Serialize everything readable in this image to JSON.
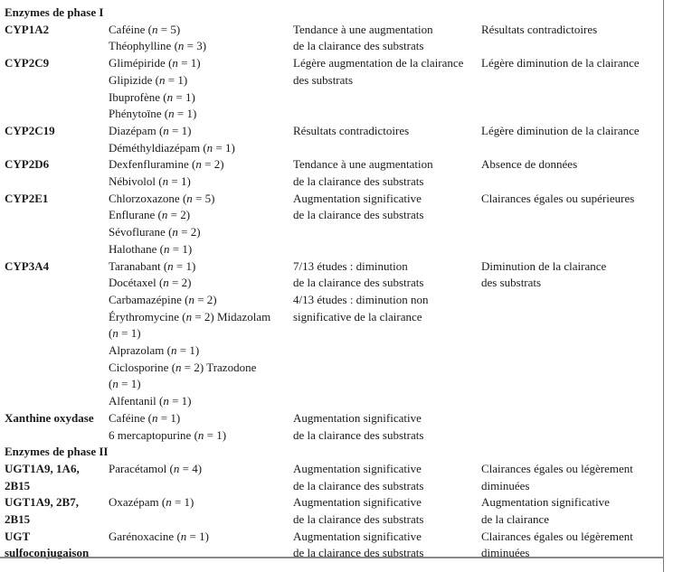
{
  "table": {
    "sections": [
      {
        "title": "Enzymes de phase I",
        "rows": [
          {
            "enzyme": [
              "CYP1A2"
            ],
            "substrates": [
              "Caféine (n = 5)",
              "Théophylline (n = 3)"
            ],
            "effect": [
              "Tendance à une augmentation",
              "de la clairance des substrats"
            ],
            "result": [
              "Résultats contradictoires"
            ]
          },
          {
            "enzyme": [
              "CYP2C9"
            ],
            "substrates": [
              "Glimépiride (n = 1)",
              "Glipizide (n = 1)",
              "Ibuprofène (n = 1)",
              "Phénytoïne (n = 1)"
            ],
            "effect": [
              "Légère augmentation de la clairance",
              "des substrats"
            ],
            "result": [
              "Légère diminution de la clairance"
            ]
          },
          {
            "enzyme": [
              "CYP2C19"
            ],
            "substrates": [
              "Diazépam (n = 1)",
              "Déméthyldiazépam (n = 1)"
            ],
            "effect": [
              "Résultats contradictoires"
            ],
            "result": [
              "Légère diminution de la clairance"
            ]
          },
          {
            "enzyme": [
              "CYP2D6"
            ],
            "substrates": [
              "Dexfenfluramine (n = 2)",
              "Nébivolol (n = 1)"
            ],
            "effect": [
              "Tendance à une augmentation",
              "de la clairance des substrats"
            ],
            "result": [
              "Absence de données"
            ]
          },
          {
            "enzyme": [
              "CYP2E1"
            ],
            "substrates": [
              "Chlorzoxazone (n = 5)",
              "Enflurane (n = 2)",
              "Sévoflurane (n = 2)",
              "Halothane (n = 1)"
            ],
            "effect": [
              "Augmentation significative",
              "de la clairance des substrats"
            ],
            "result": [
              "Clairances égales ou supérieures"
            ]
          },
          {
            "enzyme": [
              "CYP3A4"
            ],
            "substrates": [
              "Taranabant (n = 1)",
              "Docétaxel (n = 2)",
              "Carbamazépine (n = 2)",
              "Érythromycine (n = 2) Midazolam",
              "(n = 1)",
              "Alprazolam (n = 1)",
              "Ciclosporine (n = 2) Trazodone",
              "(n = 1)",
              "Alfentanil (n = 1)"
            ],
            "effect": [
              "7/13 études : diminution",
              "de la clairance des substrats",
              "4/13 études : diminution non",
              "significative de la clairance"
            ],
            "result": [
              "Diminution de la clairance",
              "des substrats"
            ]
          },
          {
            "enzyme": [
              "Xanthine oxydase"
            ],
            "substrates": [
              "Caféine (n = 1)",
              "6 mercaptopurine (n = 1)"
            ],
            "effect": [
              "Augmentation significative",
              "de la clairance des substrats"
            ],
            "result": []
          }
        ]
      },
      {
        "title": "Enzymes de phase II",
        "rows": [
          {
            "enzyme": [
              "UGT1A9, 1A6,",
              "2B15"
            ],
            "substrates": [
              "Paracétamol (n = 4)"
            ],
            "effect": [
              "Augmentation significative",
              "de la clairance des substrats"
            ],
            "result": [
              "Clairances égales ou légèrement",
              "diminuées"
            ]
          },
          {
            "enzyme": [
              "UGT1A9, 2B7,",
              "2B15"
            ],
            "substrates": [
              "Oxazépam (n = 1)"
            ],
            "effect": [
              "Augmentation significative",
              "de la clairance des substrats"
            ],
            "result": [
              "Augmentation significative",
              "de la clairance"
            ]
          },
          {
            "enzyme": [
              "UGT",
              "sulfoconjugaison"
            ],
            "substrates": [
              "Garénoxacine (n = 1)"
            ],
            "effect": [
              "Augmentation significative",
              "de la clairance des substrats"
            ],
            "result": [
              "Clairances égales ou légèrement",
              "diminuées"
            ]
          }
        ]
      }
    ]
  }
}
